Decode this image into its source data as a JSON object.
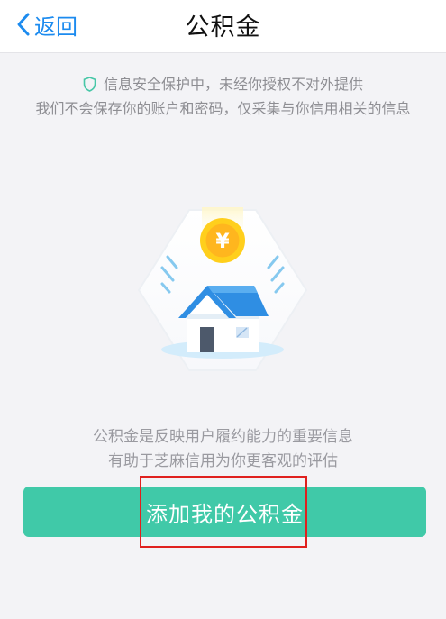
{
  "nav": {
    "back_label": "返回",
    "title": "公积金"
  },
  "notice": {
    "line1": "信息安全保护中，未经你授权不对外提供",
    "line2": "我们不会保存你的账户和密码，仅采集与你信用相关的信息"
  },
  "illustration": {
    "coin_symbol": "¥"
  },
  "description": {
    "line1": "公积金是反映用户履约能力的重要信息",
    "line2": "有助于芝麻信用为你更客观的评估"
  },
  "action": {
    "add_label": "添加我的公积金"
  },
  "colors": {
    "accent": "#40c9a8",
    "link": "#1c8bef",
    "highlight": "#e0201e",
    "background": "#f3f3f6"
  },
  "icons": [
    "chevron-left-icon",
    "shield-icon",
    "house-icon",
    "yuan-coin-icon"
  ]
}
